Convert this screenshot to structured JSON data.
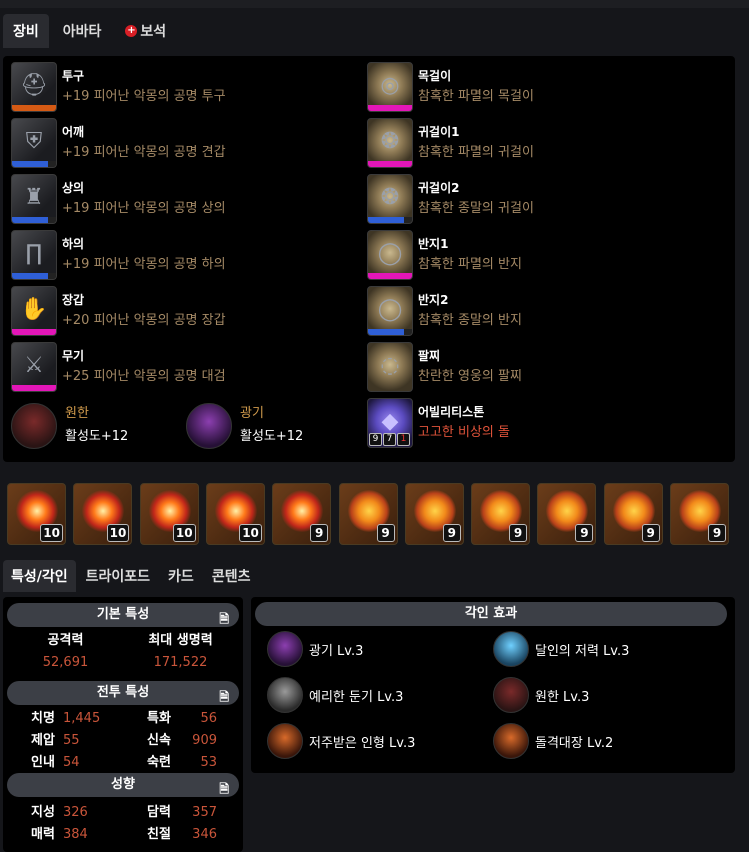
{
  "tabs": {
    "equipment": "장비",
    "avatar": "아바타",
    "gem_badge": "+",
    "gem": "보석"
  },
  "colors": {
    "panel": "#000000",
    "orange_bar": "#d55a14",
    "blue_bar": "#2f5fd6",
    "pink_bar": "#e316b8",
    "value_red": "#c9553a",
    "item_name": "#a58a66"
  },
  "equipment": {
    "left": [
      {
        "slot": "투구",
        "name": "+19 피어난 악몽의 공명 투구",
        "bar_color": "#d55a14",
        "bar_fill": 1.0,
        "icon": "helmet-icon"
      },
      {
        "slot": "어깨",
        "name": "+19 피어난 악몽의 공명 견갑",
        "bar_color": "#2f5fd6",
        "bar_fill": 0.82,
        "icon": "shoulder-icon"
      },
      {
        "slot": "상의",
        "name": "+19 피어난 악몽의 공명 상의",
        "bar_color": "#2f5fd6",
        "bar_fill": 0.82,
        "icon": "chest-icon"
      },
      {
        "slot": "하의",
        "name": "+19 피어난 악몽의 공명 하의",
        "bar_color": "#2f5fd6",
        "bar_fill": 0.82,
        "icon": "pants-icon"
      },
      {
        "slot": "장갑",
        "name": "+20 피어난 악몽의 공명 장갑",
        "bar_color": "#e316b8",
        "bar_fill": 1.0,
        "icon": "gloves-icon"
      },
      {
        "slot": "무기",
        "name": "+25 피어난 악몽의 공명 대검",
        "bar_color": "#e316b8",
        "bar_fill": 1.0,
        "icon": "greatsword-icon"
      }
    ],
    "right": [
      {
        "slot": "목걸이",
        "name": "참혹한 파멸의 목걸이",
        "bar_color": "#e316b8",
        "bar_fill": 1.0,
        "icon": "necklace-icon"
      },
      {
        "slot": "귀걸이1",
        "name": "참혹한 파멸의 귀걸이",
        "bar_color": "#e316b8",
        "bar_fill": 1.0,
        "icon": "earring-icon"
      },
      {
        "slot": "귀걸이2",
        "name": "참혹한 종말의 귀걸이",
        "bar_color": "#2f5fd6",
        "bar_fill": 0.82,
        "icon": "earring-icon"
      },
      {
        "slot": "반지1",
        "name": "참혹한 파멸의 반지",
        "bar_color": "#e316b8",
        "bar_fill": 1.0,
        "icon": "ring-icon"
      },
      {
        "slot": "반지2",
        "name": "참혹한 종말의 반지",
        "bar_color": "#2f5fd6",
        "bar_fill": 0.82,
        "icon": "ring-icon"
      },
      {
        "slot": "팔찌",
        "name": "찬란한 영웅의 팔찌",
        "bar_color": "",
        "bar_fill": 0,
        "icon": "bracelet-icon"
      }
    ],
    "ability_stone": {
      "slot": "어빌리티스톤",
      "name": "고고한 비상의 돌",
      "stones": [
        "9",
        "7",
        "1"
      ],
      "icon": "ability-stone-icon"
    },
    "engravings_active": [
      {
        "name": "원한",
        "value": "활성도+12",
        "icon": "grudge-icon"
      },
      {
        "name": "광기",
        "value": "활성도+12",
        "icon": "madness-icon"
      }
    ]
  },
  "gems": [
    {
      "level": "10",
      "type": "red"
    },
    {
      "level": "10",
      "type": "red"
    },
    {
      "level": "10",
      "type": "red"
    },
    {
      "level": "10",
      "type": "red"
    },
    {
      "level": "9",
      "type": "red"
    },
    {
      "level": "9",
      "type": "orange"
    },
    {
      "level": "9",
      "type": "orange"
    },
    {
      "level": "9",
      "type": "orange"
    },
    {
      "level": "9",
      "type": "orange"
    },
    {
      "level": "9",
      "type": "orange"
    },
    {
      "level": "9",
      "type": "orange"
    }
  ],
  "tabs2": {
    "traits": "특성/각인",
    "tripod": "트라이포드",
    "card": "카드",
    "content": "콘텐츠"
  },
  "basic": {
    "title": "기본 특성",
    "attack_label": "공격력",
    "attack": "52,691",
    "hp_label": "최대 생명력",
    "hp": "171,522"
  },
  "combat": {
    "title": "전투 특성",
    "stats": [
      {
        "k": "치명",
        "v": "1,445"
      },
      {
        "k": "특화",
        "v": "56"
      },
      {
        "k": "제압",
        "v": "55"
      },
      {
        "k": "신속",
        "v": "909"
      },
      {
        "k": "인내",
        "v": "54"
      },
      {
        "k": "숙련",
        "v": "53"
      }
    ]
  },
  "tendency": {
    "title": "성향",
    "stats": [
      {
        "k": "지성",
        "v": "326"
      },
      {
        "k": "담력",
        "v": "357"
      },
      {
        "k": "매력",
        "v": "384"
      },
      {
        "k": "친절",
        "v": "346"
      }
    ]
  },
  "engravings": {
    "title": "각인 효과",
    "items": [
      {
        "label": "광기 Lv.3",
        "icon": "madness-icon"
      },
      {
        "label": "달인의 저력 Lv.3",
        "icon": "masters-tenacity-icon"
      },
      {
        "label": "예리한 둔기 Lv.3",
        "icon": "keen-blunt-weapon-icon"
      },
      {
        "label": "원한 Lv.3",
        "icon": "grudge-icon"
      },
      {
        "label": "저주받은 인형 Lv.3",
        "icon": "cursed-doll-icon"
      },
      {
        "label": "돌격대장 Lv.2",
        "icon": "raid-captain-icon"
      }
    ]
  }
}
